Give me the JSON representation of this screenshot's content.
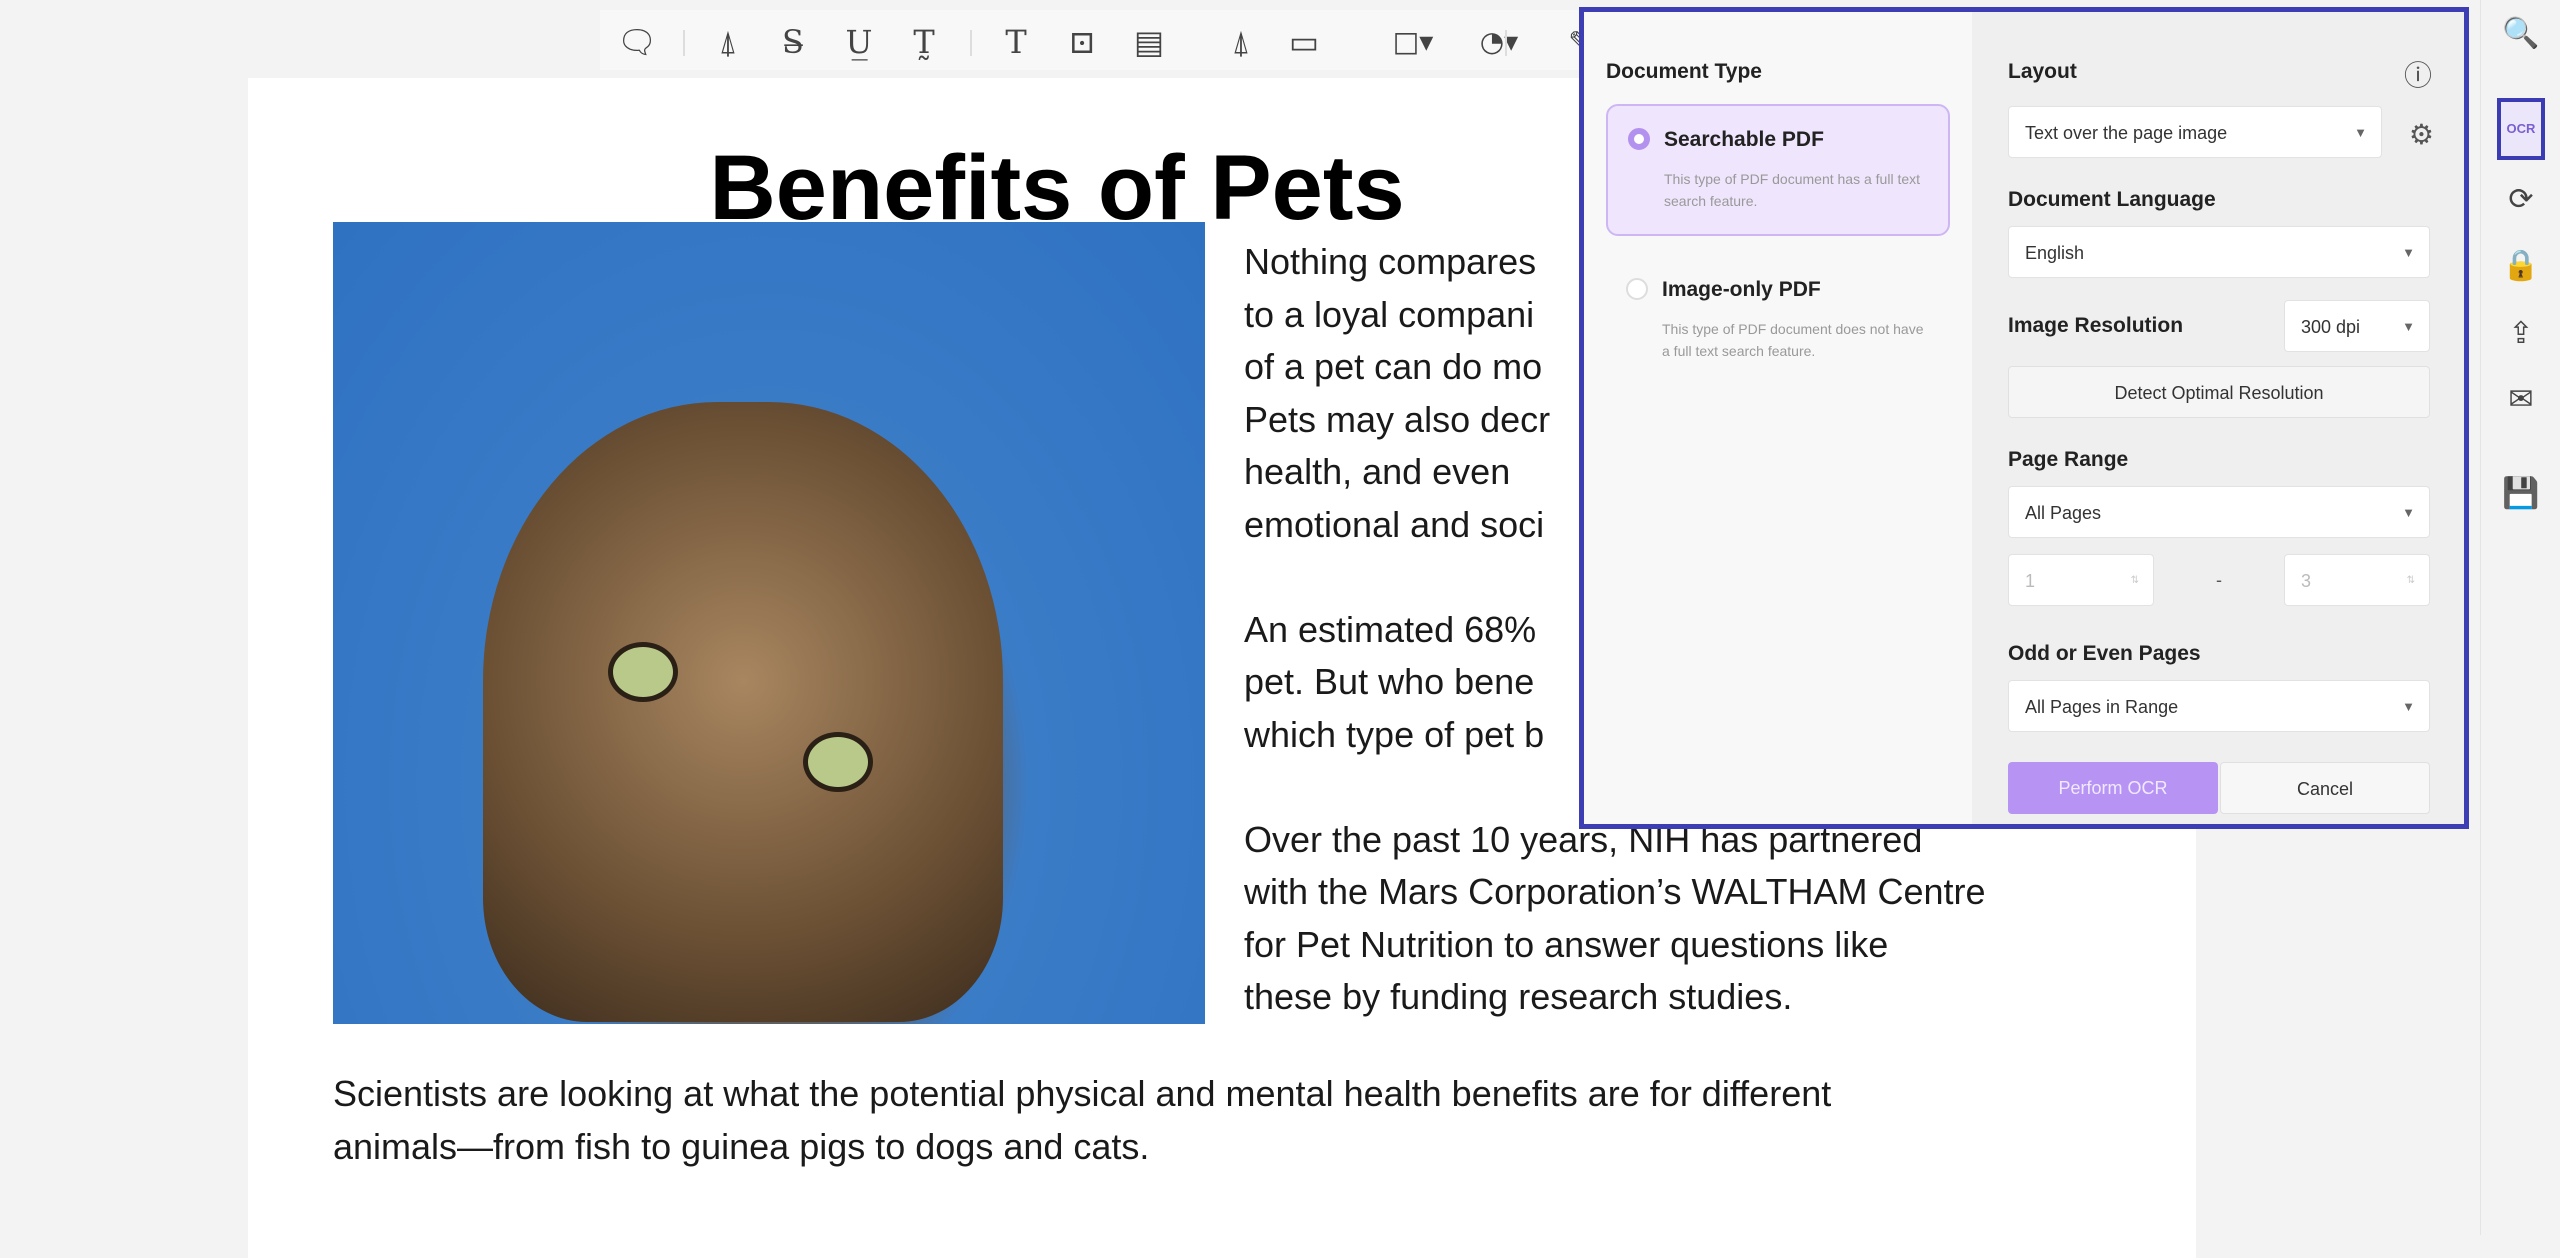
{
  "toolbar": {
    "icons": [
      "comment-icon",
      "highlighter-icon",
      "strikethrough-icon",
      "underline-icon",
      "squiggly-icon",
      "text-icon",
      "textbox-icon",
      "callout-icon",
      "pencil-icon",
      "eraser-icon",
      "shape-icon",
      "stamp-icon",
      "pin-icon"
    ],
    "glyphs": [
      "🗨",
      "⍋",
      "S̶",
      "U̲",
      "T̰",
      "T",
      "⊡",
      "▤",
      "⍋",
      "▭",
      "□▾",
      "◔▾",
      "✎"
    ]
  },
  "document": {
    "title": "Benefits of Pets",
    "col_lines": [
      "Nothing compares",
      "to a loyal compani",
      "of a pet can do mo",
      "Pets may also decr",
      "health, and even",
      "emotional and soci",
      "",
      "An estimated 68%",
      "pet. But who bene",
      "which type of pet b",
      "",
      "Over the past 10 years, NIH has partnered",
      "with the Mars Corporation’s WALTHAM Centre",
      "for Pet Nutrition to answer questions like",
      "these by funding research studies."
    ],
    "bottom_lines": [
      "Scientists are looking at what the potential physical and mental health benefits are for different",
      "animals—from fish to guinea pigs to dogs and cats."
    ]
  },
  "ocr": {
    "document_type_label": "Document Type",
    "options": [
      {
        "label": "Searchable PDF",
        "desc": "This type of PDF document has a full text search feature.",
        "selected": true
      },
      {
        "label": "Image-only PDF",
        "desc": "This type of PDF document does not have a full text search feature.",
        "selected": false
      }
    ],
    "layout_label": "Layout",
    "layout_value": "Text over the page image",
    "language_label": "Document Language",
    "language_value": "English",
    "resolution_label": "Image Resolution",
    "resolution_value": "300 dpi",
    "detect_button": "Detect Optimal Resolution",
    "page_range_label": "Page Range",
    "page_range_value": "All Pages",
    "range_from": "1",
    "range_to": "3",
    "range_dash": "-",
    "odd_even_label": "Odd or Even Pages",
    "odd_even_value": "All Pages in Range",
    "perform_button": "Perform OCR",
    "cancel_button": "Cancel",
    "accent": "#b794f4",
    "border": "#3d3db4"
  },
  "sidebar": {
    "items": [
      {
        "icon": "search-icon",
        "glyph": "🔍"
      },
      {
        "icon": "ocr-icon",
        "glyph": "OCR",
        "active": true
      },
      {
        "icon": "convert-icon",
        "glyph": "⟳"
      },
      {
        "icon": "protect-icon",
        "glyph": "🔒"
      },
      {
        "icon": "share-icon",
        "glyph": "⇪"
      },
      {
        "icon": "email-icon",
        "glyph": "✉"
      },
      {
        "icon": "save-icon",
        "glyph": "💾"
      }
    ]
  }
}
